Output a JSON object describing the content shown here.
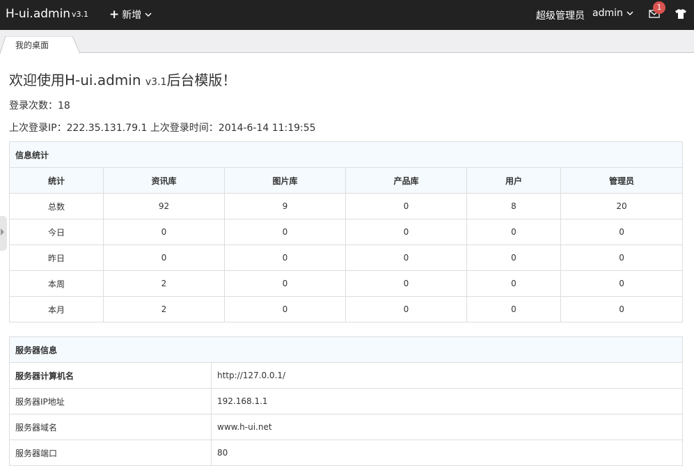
{
  "navbar": {
    "logo": "H-ui.admin",
    "version": "v3.1",
    "add_label": "新增",
    "role": "超级管理员",
    "user": "admin",
    "message_count": "1",
    "colors": {
      "bar": "#222222",
      "badge": "#d9534f"
    }
  },
  "tabs": [
    {
      "label": "我的桌面"
    }
  ],
  "content": {
    "welcome_prefix": "欢迎使用H-ui.admin ",
    "welcome_version": "v3.1",
    "welcome_suffix": "后台模版！",
    "login_count_line": "登录次数：18",
    "last_login_line": "上次登录IP：222.35.131.79.1 上次登录时间：2014-6-14 11:19:55"
  },
  "stats": {
    "title": "信息统计",
    "headers": [
      "统计",
      "资讯库",
      "图片库",
      "产品库",
      "用户",
      "管理员"
    ],
    "rows": [
      [
        "总数",
        "92",
        "9",
        "0",
        "8",
        "20"
      ],
      [
        "今日",
        "0",
        "0",
        "0",
        "0",
        "0"
      ],
      [
        "昨日",
        "0",
        "0",
        "0",
        "0",
        "0"
      ],
      [
        "本周",
        "2",
        "0",
        "0",
        "0",
        "0"
      ],
      [
        "本月",
        "2",
        "0",
        "0",
        "0",
        "0"
      ]
    ]
  },
  "server": {
    "title": "服务器信息",
    "rows": [
      [
        "服务器计算机名",
        "http://127.0.0.1/"
      ],
      [
        "服务器IP地址",
        "192.168.1.1"
      ],
      [
        "服务器域名",
        "www.h-ui.net"
      ],
      [
        "服务器端口",
        "80"
      ]
    ]
  }
}
